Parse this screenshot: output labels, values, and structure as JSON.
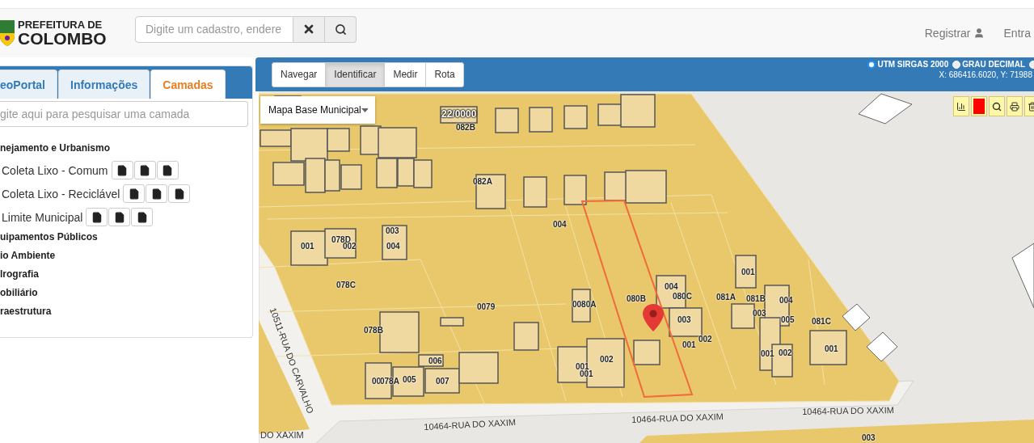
{
  "header": {
    "logo_top": "PREFEITURA DE",
    "logo_bottom": "COLOMBO",
    "search": {
      "placeholder": "Digite um cadastro, endere"
    },
    "links": [
      "Registrar",
      "Entra"
    ]
  },
  "sidebar": {
    "tabs": [
      {
        "label": "eoPortal",
        "selected": false
      },
      {
        "label": "Informações",
        "selected": false
      },
      {
        "label": "Camadas",
        "selected": true
      }
    ],
    "search": {
      "placeholder": "gite aqui para pesquisar uma camada"
    },
    "layers": [
      {
        "label": "nejamento e Urbanismo",
        "children": [
          {
            "label": "Coleta Lixo - Comum"
          },
          {
            "label": "Coleta Lixo - Reciclável"
          },
          {
            "label": "Limite Municipal"
          }
        ]
      },
      {
        "label": "uipamentos Públicos"
      },
      {
        "label": "io Ambiente"
      },
      {
        "label": "lrografia"
      },
      {
        "label": "obiliário"
      },
      {
        "label": "raestrutura"
      }
    ]
  },
  "map": {
    "modes": [
      {
        "label": "Navegar",
        "selected": false
      },
      {
        "label": "Identificar",
        "selected": true
      },
      {
        "label": "Medir",
        "selected": false
      },
      {
        "label": "Rota",
        "selected": false
      }
    ],
    "projections": [
      {
        "label": "UTM SIRGAS 2000",
        "selected": true
      },
      {
        "label": "GRAU DECIMAL",
        "selected": false
      },
      {
        "selected": false
      }
    ],
    "coordinates": "X: 686416.6020, Y: 71988",
    "base_layer": "Mapa Base Municipal",
    "block_label": "22/0000",
    "lot_labels": [
      "082B",
      "082A",
      "004",
      "003",
      "001",
      "078D",
      "002",
      "004",
      "078C",
      "0079",
      "0080A",
      "080B",
      "004",
      "080C",
      "081A",
      "081B",
      "001",
      "004",
      "003",
      "003",
      "005",
      "081C",
      "078B",
      "002",
      "001",
      "001",
      "002",
      "001",
      "006",
      "002",
      "001",
      "001",
      "00",
      "078A",
      "005",
      "007",
      "003"
    ],
    "street_labels": [
      "10511-RUA DO CARVALHO",
      "10464-RUA DO XAXIM",
      "10464-RUA DO XAXIM",
      "10464-RUA DO XAXIM",
      "DO XAXIM"
    ]
  }
}
